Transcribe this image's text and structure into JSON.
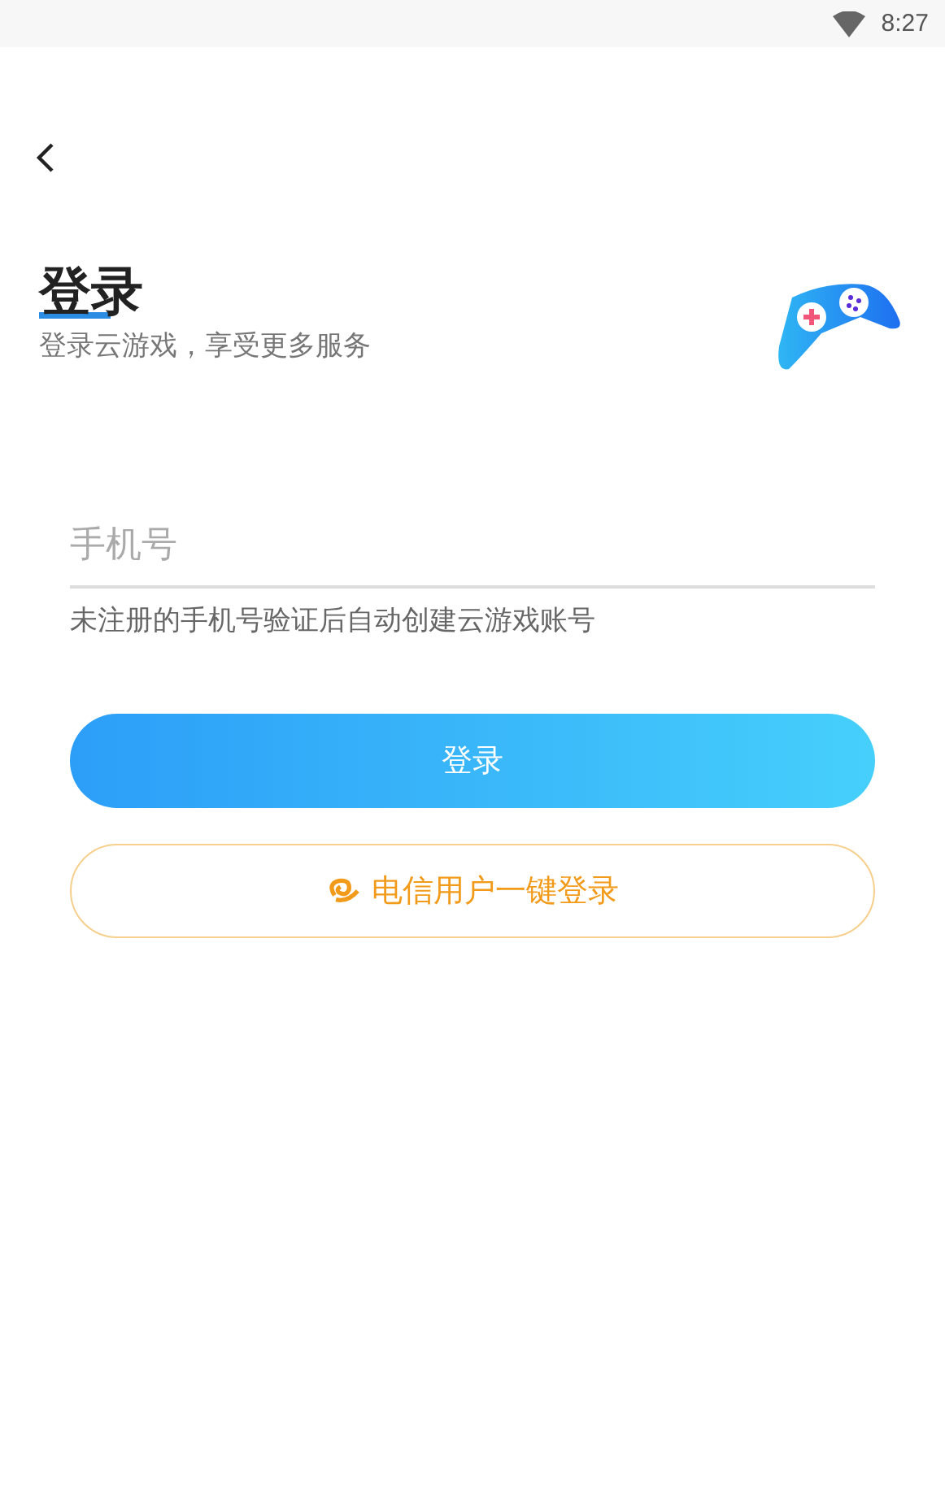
{
  "status_bar": {
    "time": "8:27"
  },
  "header": {
    "title": "登录",
    "subtitle": "登录云游戏，享受更多服务"
  },
  "phone_field": {
    "placeholder": "手机号"
  },
  "hint": "未注册的手机号验证后自动创建云游戏账号",
  "buttons": [
    {
      "kind": "primary",
      "label": "登录"
    },
    {
      "kind": "telecom",
      "label": "电信用户一键登录"
    }
  ]
}
